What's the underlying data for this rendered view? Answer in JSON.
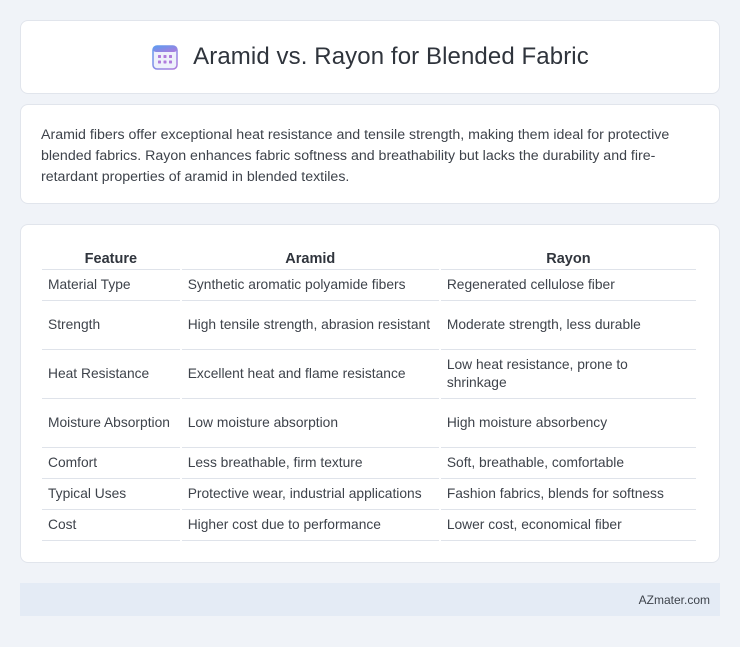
{
  "header": {
    "title": "Aramid vs. Rayon for Blended Fabric",
    "icon": "calendar-grid-icon"
  },
  "intro": {
    "text": "Aramid fibers offer exceptional heat resistance and tensile strength, making them ideal for protective blended fabrics. Rayon enhances fabric softness and breathability but lacks the durability and fire-retardant properties of aramid in blended textiles."
  },
  "table": {
    "headers": [
      "Feature",
      "Aramid",
      "Rayon"
    ],
    "rows": [
      [
        "Material Type",
        "Synthetic aromatic polyamide fibers",
        "Regenerated cellulose fiber"
      ],
      [
        "Strength",
        "High tensile strength, abrasion resistant",
        "Moderate strength, less durable"
      ],
      [
        "Heat Resistance",
        "Excellent heat and flame resistance",
        "Low heat resistance, prone to shrinkage"
      ],
      [
        "Moisture Absorption",
        "Low moisture absorption",
        "High moisture absorbency"
      ],
      [
        "Comfort",
        "Less breathable, firm texture",
        "Soft, breathable, comfortable"
      ],
      [
        "Typical Uses",
        "Protective wear, industrial applications",
        "Fashion fabrics, blends for softness"
      ],
      [
        "Cost",
        "Higher cost due to performance",
        "Lower cost, economical fiber"
      ]
    ]
  },
  "footer": {
    "brand": "AZmater.com"
  },
  "colors": {
    "background": "#f0f3f8",
    "card": "#ffffff",
    "footer": "#e4ebf5",
    "icon_blue": "#6b8fe0",
    "icon_purple": "#a97ad8"
  }
}
